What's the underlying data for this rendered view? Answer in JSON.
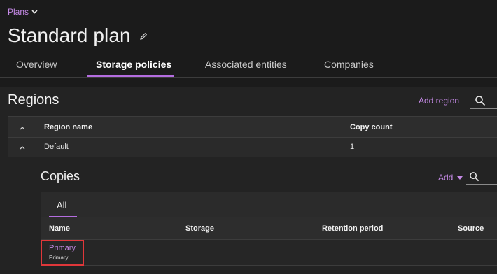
{
  "breadcrumb": {
    "label": "Plans"
  },
  "page": {
    "title": "Standard plan"
  },
  "tabs": [
    {
      "label": "Overview"
    },
    {
      "label": "Storage policies"
    },
    {
      "label": "Associated entities"
    },
    {
      "label": "Companies"
    }
  ],
  "active_tab": "Storage policies",
  "regions": {
    "title": "Regions",
    "add_label": "Add region",
    "columns": [
      "Region name",
      "Copy count"
    ],
    "rows": [
      {
        "name": "Default",
        "copy_count": "1"
      }
    ]
  },
  "copies": {
    "title": "Copies",
    "add_label": "Add",
    "tabs": [
      "All"
    ],
    "columns": [
      "Name",
      "Storage",
      "Retention period",
      "Source"
    ],
    "rows": [
      {
        "name": "Primary",
        "subtitle": "Primary"
      }
    ]
  },
  "colors": {
    "accent": "#c58ae6",
    "highlight": "#e0373a",
    "background": "#1b1b1b"
  }
}
